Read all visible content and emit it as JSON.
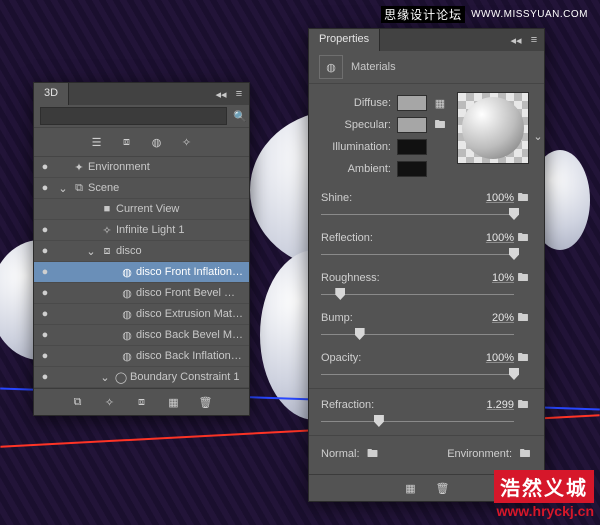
{
  "watermark_top_cn": "思缘设计论坛",
  "watermark_top_en": "WWW.MISSYUAN.COM",
  "watermark_br_logo": "浩然义城",
  "watermark_br_url": "www.hryckj.cn",
  "panel3d": {
    "title": "3D",
    "search_placeholder": "",
    "tree": [
      {
        "eye": "●",
        "tw": "",
        "ic": "✦",
        "label": "Environment",
        "indent": 0,
        "sel": false
      },
      {
        "eye": "●",
        "tw": "⌄",
        "ic": "⧉",
        "label": "Scene",
        "indent": 0,
        "sel": false
      },
      {
        "eye": "",
        "tw": "",
        "ic": "■",
        "label": "Current View",
        "indent": 2,
        "sel": false
      },
      {
        "eye": "●",
        "tw": "",
        "ic": "✧",
        "label": "Infinite Light 1",
        "indent": 2,
        "sel": false
      },
      {
        "eye": "●",
        "tw": "⌄",
        "ic": "⧈",
        "label": "disco",
        "indent": 2,
        "sel": false
      },
      {
        "eye": "●",
        "tw": "",
        "ic": "◍",
        "label": "disco Front Inflation Mat...",
        "indent": 4,
        "sel": true
      },
      {
        "eye": "●",
        "tw": "",
        "ic": "◍",
        "label": "disco Front Bevel Material",
        "indent": 4,
        "sel": false
      },
      {
        "eye": "●",
        "tw": "",
        "ic": "◍",
        "label": "disco Extrusion Material",
        "indent": 4,
        "sel": false
      },
      {
        "eye": "●",
        "tw": "",
        "ic": "◍",
        "label": "disco Back Bevel Material",
        "indent": 4,
        "sel": false
      },
      {
        "eye": "●",
        "tw": "",
        "ic": "◍",
        "label": "disco Back Inflation Mate...",
        "indent": 4,
        "sel": false
      },
      {
        "eye": "●",
        "tw": "⌄",
        "ic": "◯",
        "label": "Boundary Constraint 1",
        "indent": 3,
        "sel": false
      }
    ]
  },
  "props": {
    "title": "Properties",
    "section": "Materials",
    "diffuse": "Diffuse:",
    "specular": "Specular:",
    "illumination": "Illumination:",
    "ambient": "Ambient:",
    "sliders": [
      {
        "name": "Shine:",
        "val": "100%",
        "pos": 100
      },
      {
        "name": "Reflection:",
        "val": "100%",
        "pos": 100
      },
      {
        "name": "Roughness:",
        "val": "10%",
        "pos": 10
      },
      {
        "name": "Bump:",
        "val": "20%",
        "pos": 20
      },
      {
        "name": "Opacity:",
        "val": "100%",
        "pos": 100
      }
    ],
    "refraction_name": "Refraction:",
    "refraction_val": "1.299",
    "refraction_pos": 30,
    "normal": "Normal:",
    "environment": "Environment:"
  }
}
